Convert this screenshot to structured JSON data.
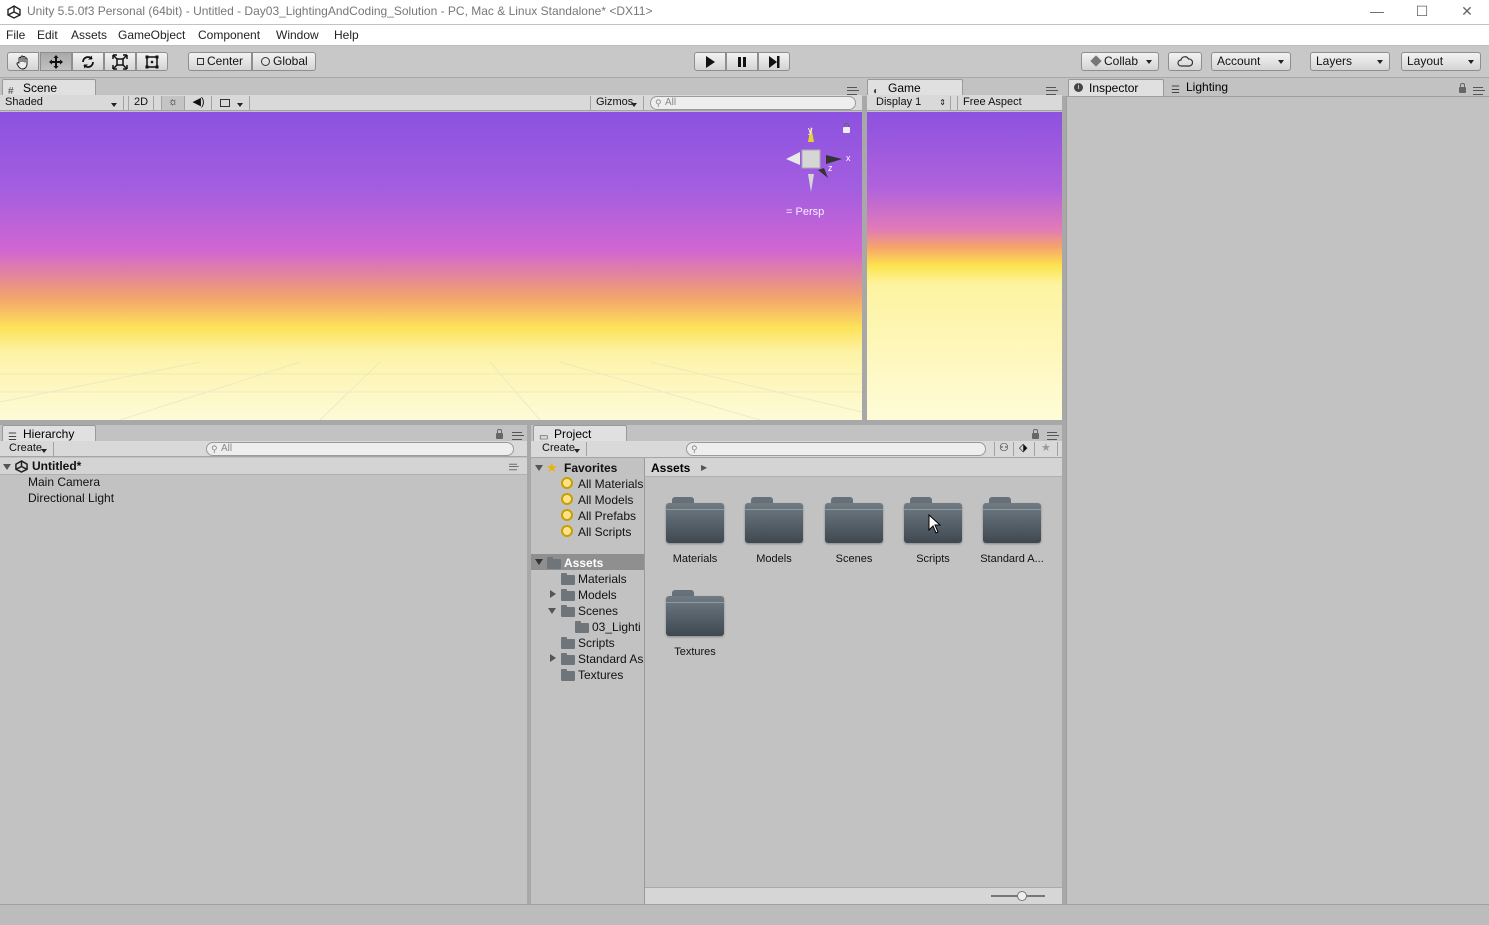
{
  "window": {
    "title": "Unity 5.5.0f3 Personal (64bit) - Untitled - Day03_LightingAndCoding_Solution - PC, Mac & Linux Standalone* <DX11>",
    "minimize": "—",
    "maximize": "☐",
    "close": "✕"
  },
  "menu": [
    "File",
    "Edit",
    "Assets",
    "GameObject",
    "Component",
    "Window",
    "Help"
  ],
  "toolbar": {
    "pivot": "Center",
    "space": "Global",
    "collab": "Collab",
    "account": "Account",
    "layers": "Layers",
    "layout": "Layout"
  },
  "scene": {
    "tab": "Scene",
    "shading": "Shaded",
    "mode2d": "2D",
    "gizmos": "Gizmos",
    "search_placeholder": "All",
    "gizmo_x": "x",
    "gizmo_y": "y",
    "gizmo_z": "z",
    "projection": "Persp"
  },
  "game": {
    "tab": "Game",
    "display": "Display 1",
    "aspect": "Free Aspect"
  },
  "inspector": {
    "tab": "Inspector",
    "lighting_tab": "Lighting"
  },
  "hierarchy": {
    "tab": "Hierarchy",
    "create": "Create",
    "search_placeholder": "All",
    "scene_name": "Untitled*",
    "items": [
      "Main Camera",
      "Directional Light"
    ]
  },
  "project": {
    "tab": "Project",
    "create": "Create",
    "favorites_label": "Favorites",
    "favorites": [
      "All Materials",
      "All Models",
      "All Prefabs",
      "All Scripts"
    ],
    "assets_label": "Assets",
    "tree": [
      "Materials",
      "Models",
      "Scenes",
      "03_Lighti",
      "Scripts",
      "Standard As",
      "Textures"
    ],
    "breadcrumb": "Assets",
    "folders": [
      "Materials",
      "Models",
      "Scenes",
      "Scripts",
      "Standard A...",
      "Textures"
    ]
  },
  "icons": [
    "unity-logo-icon",
    "hand-tool-icon",
    "move-tool-icon",
    "rotate-tool-icon",
    "scale-tool-icon",
    "rect-tool-icon",
    "play-icon",
    "pause-icon",
    "step-icon",
    "cloud-icon",
    "lock-icon",
    "menu-icon",
    "folder-icon",
    "favorite-search-icon"
  ],
  "colors": {
    "sky_top": "#8c52df",
    "sky_horizon": "#fde25a",
    "ground": "#fdfbd8",
    "panel_bg": "#c2c2c2"
  }
}
